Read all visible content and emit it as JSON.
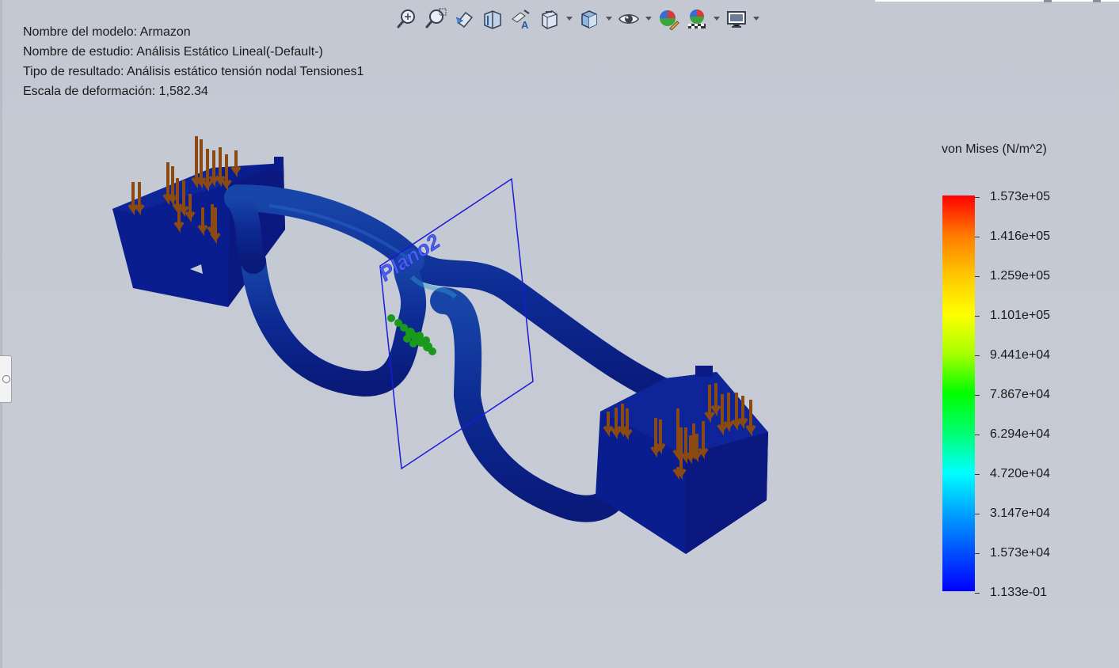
{
  "info": {
    "model_name": "Nombre del modelo: Armazon",
    "study_name": "Nombre de estudio: Análisis Estático Lineal(-Default-)",
    "result_type": "Tipo de resultado: Análisis estático tensión nodal Tensiones1",
    "deformation_scale": "Escala de deformación: 1,582.34"
  },
  "toolbar": {
    "buttons": [
      {
        "icon": "zoom-to-fit-icon",
        "has_menu": false
      },
      {
        "icon": "zoom-to-area-icon",
        "has_menu": false
      },
      {
        "icon": "previous-view-icon",
        "has_menu": false
      },
      {
        "icon": "section-view-icon",
        "has_menu": false
      },
      {
        "icon": "dynamic-annotation-views-icon",
        "has_menu": false
      },
      {
        "icon": "view-orientation-icon",
        "has_menu": true
      },
      {
        "icon": "display-style-icon",
        "has_menu": true
      },
      {
        "icon": "hide-show-items-icon",
        "has_menu": true
      },
      {
        "icon": "edit-appearance-icon",
        "has_menu": false
      },
      {
        "icon": "apply-scene-icon",
        "has_menu": true
      },
      {
        "icon": "view-settings-icon",
        "has_menu": true
      }
    ]
  },
  "viewport": {
    "plane_label": "Plano2"
  },
  "legend": {
    "title": "von Mises (N/m^2)",
    "labels": [
      "1.573e+05",
      "1.416e+05",
      "1.259e+05",
      "1.101e+05",
      "9.441e+04",
      "7.867e+04",
      "6.294e+04",
      "4.720e+04",
      "3.147e+04",
      "1.573e+04",
      "1.133e-01"
    ],
    "max_color": "#ff0000",
    "min_color": "#0000ff"
  },
  "colors": {
    "background": "#c5cad4",
    "model_blue": "#0c1f8a",
    "load_arrow": "#8a4a12",
    "fixture": "#1a9a1a",
    "plane": "#1a1adc"
  }
}
